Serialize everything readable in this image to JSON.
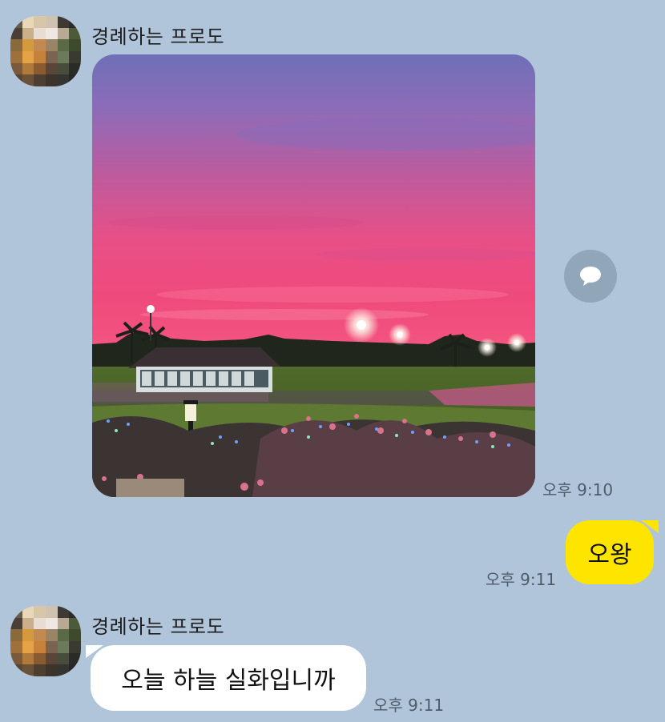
{
  "colors": {
    "background": "#b1c5da",
    "my_bubble": "#fee500",
    "their_bubble": "#ffffff",
    "timestamp": "#4f5c69"
  },
  "messages": [
    {
      "sender": "경례하는 프로도",
      "avatar_icon": "pixelated-profile-avatar",
      "type": "image",
      "image_description_icon": "sunset-golf-course-photo",
      "time": "오후 9:10",
      "action_icon": "share-speech-bubble-icon"
    },
    {
      "sender": "me",
      "type": "text",
      "text": "오왕",
      "time": "오후 9:11"
    },
    {
      "sender": "경례하는 프로도",
      "avatar_icon": "pixelated-profile-avatar",
      "type": "text",
      "text": "오늘 하늘 실화입니까",
      "time": "오후 9:11"
    }
  ]
}
